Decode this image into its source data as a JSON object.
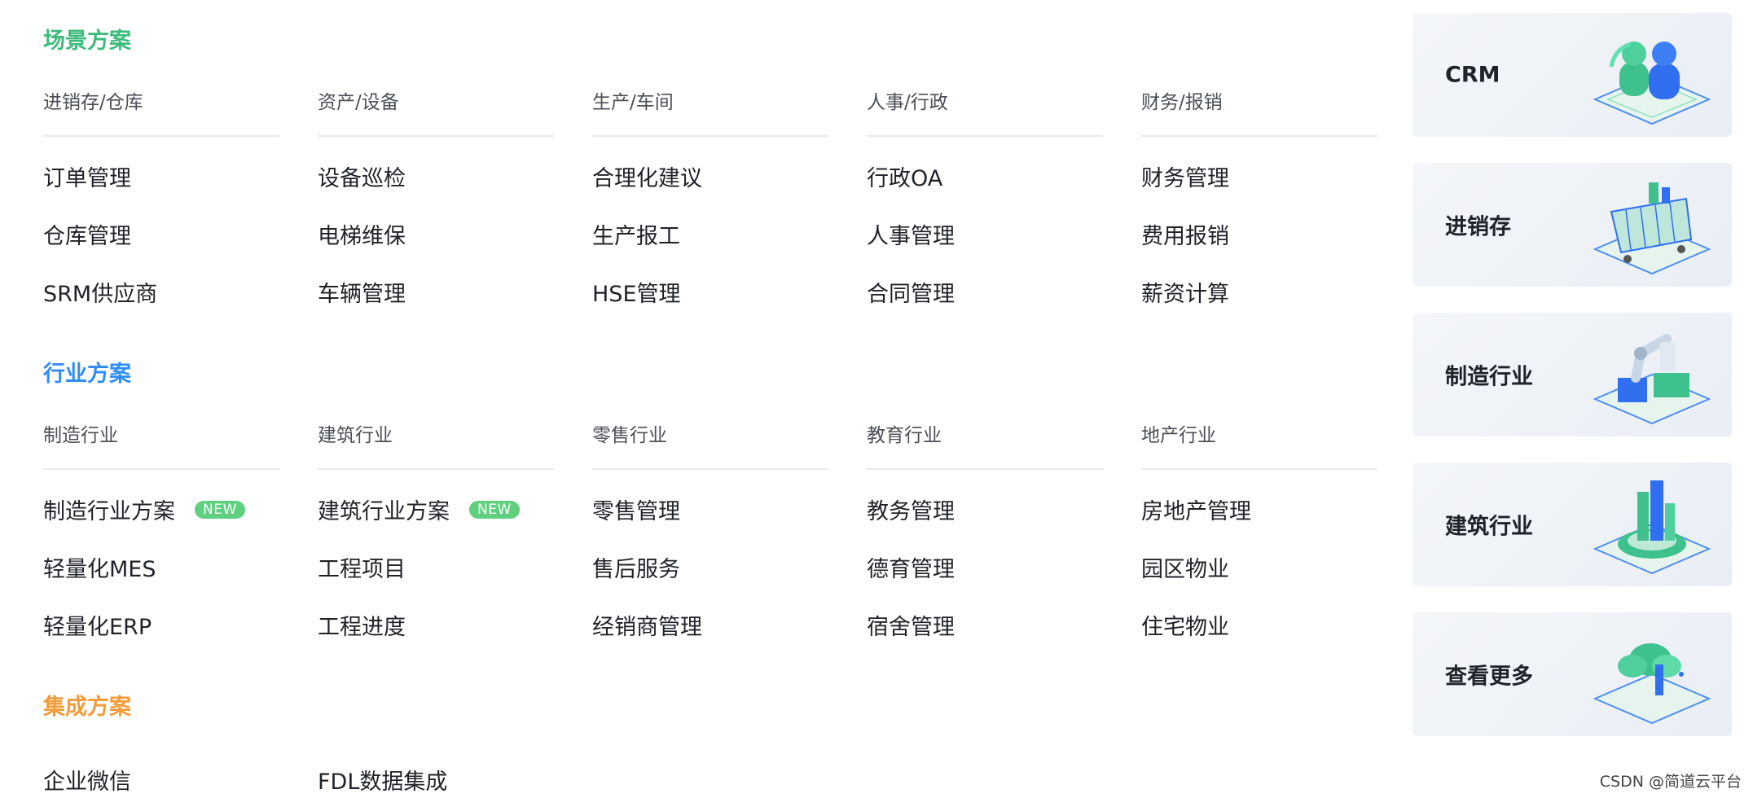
{
  "colors": {
    "scene": "#3dbb7a",
    "industry": "#2f8df6",
    "integration": "#f29b38"
  },
  "sections": {
    "scene": {
      "title": "场景方案",
      "columns": [
        {
          "header": "进销存/仓库",
          "items": [
            "订单管理",
            "仓库管理",
            "SRM供应商"
          ]
        },
        {
          "header": "资产/设备",
          "items": [
            "设备巡检",
            "电梯维保",
            "车辆管理"
          ]
        },
        {
          "header": "生产/车间",
          "items": [
            "合理化建议",
            "生产报工",
            "HSE管理"
          ]
        },
        {
          "header": "人事/行政",
          "items": [
            "行政OA",
            "人事管理",
            "合同管理"
          ]
        },
        {
          "header": "财务/报销",
          "items": [
            "财务管理",
            "费用报销",
            "薪资计算"
          ]
        }
      ]
    },
    "industry": {
      "title": "行业方案",
      "columns": [
        {
          "header": "制造行业",
          "items": [
            "制造行业方案",
            "轻量化MES",
            "轻量化ERP"
          ],
          "badge": "NEW"
        },
        {
          "header": "建筑行业",
          "items": [
            "建筑行业方案",
            "工程项目",
            "工程进度"
          ],
          "badge": "NEW"
        },
        {
          "header": "零售行业",
          "items": [
            "零售管理",
            "售后服务",
            "经销商管理"
          ]
        },
        {
          "header": "教育行业",
          "items": [
            "教务管理",
            "德育管理",
            "宿舍管理"
          ]
        },
        {
          "header": "地产行业",
          "items": [
            "房地产管理",
            "园区物业",
            "住宅物业"
          ]
        }
      ]
    },
    "integration": {
      "title": "集成方案",
      "items": [
        "企业微信",
        "FDL数据集成"
      ]
    }
  },
  "cards": [
    {
      "label": "CRM",
      "icon": "people-icon"
    },
    {
      "label": "进销存",
      "icon": "cart-icon"
    },
    {
      "label": "制造行业",
      "icon": "robot-arm-icon"
    },
    {
      "label": "建筑行业",
      "icon": "building-icon"
    },
    {
      "label": "查看更多",
      "icon": "cloud-icon"
    }
  ],
  "watermark": "CSDN @简道云平台"
}
